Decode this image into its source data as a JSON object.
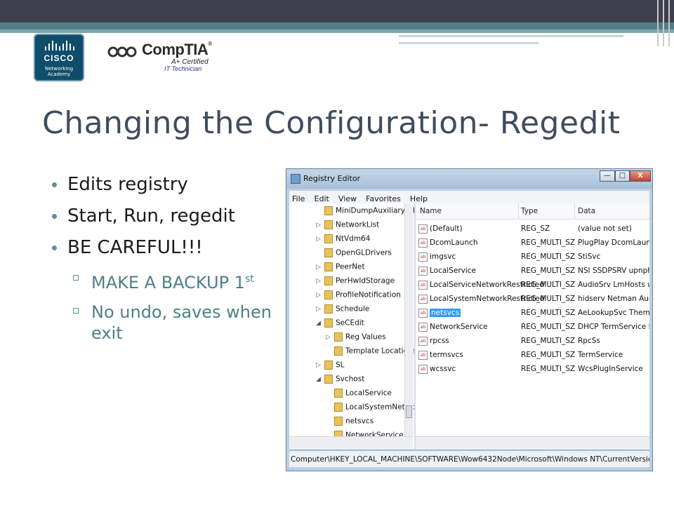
{
  "logos": {
    "cisco": {
      "word": "CISCO",
      "sub_line1": "Networking",
      "sub_line2": "Academy"
    },
    "comptia": {
      "name": "CompTIA",
      "trademark": "®",
      "line1": "A+ Certified",
      "line2": "IT Technician"
    }
  },
  "slide": {
    "title": "Changing the Configuration- Regedit",
    "bullets": [
      {
        "text": "Edits registry"
      },
      {
        "text": "Start, Run, regedit"
      },
      {
        "text": "BE CAREFUL!!!"
      }
    ],
    "sub_bullets": [
      {
        "text": "MAKE A BACKUP 1",
        "sup": "st"
      },
      {
        "text": "No undo, saves when exit"
      }
    ]
  },
  "registry_editor": {
    "title": "Registry Editor",
    "buttons": {
      "minimize": "—",
      "maximize": "□",
      "close": "X"
    },
    "menu": [
      "File",
      "Edit",
      "View",
      "Favorites",
      "Help"
    ],
    "tree_items": [
      "MiniDumpAuxiliaryDlls",
      "NetworkList",
      "NtVdm64",
      "OpenGLDrivers",
      "PeerNet",
      "PerHwIdStorage",
      "ProfileNotification",
      "Schedule",
      "SeCEdit",
      "Reg Values",
      "Template Locations",
      "SL",
      "Svchost",
      "LocalService",
      "LocalSystemNetwor",
      "netsvcs",
      "NetworkService"
    ],
    "columns": [
      "Name",
      "Type",
      "Data"
    ],
    "rows": [
      {
        "name": "(Default)",
        "type": "REG_SZ",
        "data": "(value not set)"
      },
      {
        "name": "DcomLaunch",
        "type": "REG_MULTI_SZ",
        "data": "PlugPlay DcomLaunch"
      },
      {
        "name": "imgsvc",
        "type": "REG_MULTI_SZ",
        "data": "StiSvc"
      },
      {
        "name": "LocalService",
        "type": "REG_MULTI_SZ",
        "data": "NSI SSDPSRV upnphost"
      },
      {
        "name": "LocalServiceNetworkRestricted",
        "type": "REG_MULTI_SZ",
        "data": "AudioSrv LmHosts wsc"
      },
      {
        "name": "LocalSystemNetworkRestricted",
        "type": "REG_MULTI_SZ",
        "data": "hidserv Netman Audiob"
      },
      {
        "name": "netsvcs",
        "type": "REG_MULTI_SZ",
        "data": "AeLookupSvc Themes"
      },
      {
        "name": "NetworkService",
        "type": "REG_MULTI_SZ",
        "data": "DHCP TermService DN"
      },
      {
        "name": "rpcss",
        "type": "REG_MULTI_SZ",
        "data": "RpcSs"
      },
      {
        "name": "termsvcs",
        "type": "REG_MULTI_SZ",
        "data": "TermService"
      },
      {
        "name": "wcssvc",
        "type": "REG_MULTI_SZ",
        "data": "WcsPlugInService"
      }
    ],
    "selected_row": "netsvcs",
    "status_path": "Computer\\HKEY_LOCAL_MACHINE\\SOFTWARE\\Wow6432Node\\Microsoft\\Windows NT\\CurrentVersion\\Svchost"
  },
  "colors": {
    "title": "#3f4d5e",
    "accent": "#4d7f89",
    "topbar": "#3f3f4d",
    "selection": "#3399ff"
  }
}
